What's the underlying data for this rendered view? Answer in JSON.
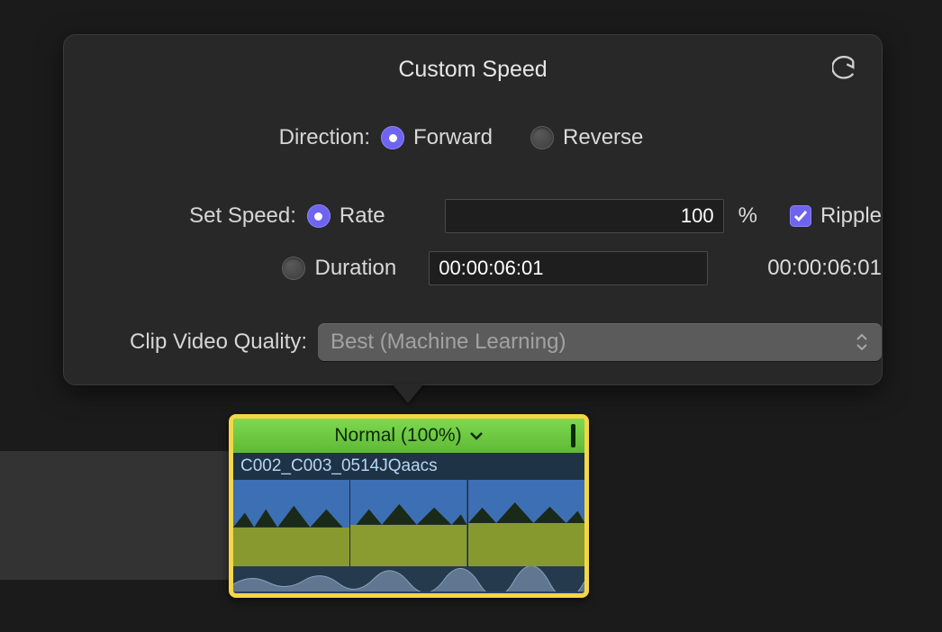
{
  "panel": {
    "title": "Custom Speed",
    "labels": {
      "direction": "Direction:",
      "set_speed": "Set Speed:",
      "clip_quality": "Clip Video Quality:"
    },
    "direction": {
      "forward": "Forward",
      "reverse": "Reverse",
      "selected": "forward"
    },
    "speed": {
      "rate_label": "Rate",
      "duration_label": "Duration",
      "mode_selected": "rate",
      "rate_value": "100",
      "rate_unit": "%",
      "duration_value": "00:00:06:01",
      "source_duration": "00:00:06:01"
    },
    "ripple": {
      "label": "Ripple",
      "checked": true
    },
    "quality": {
      "selected": "Best (Machine Learning)"
    }
  },
  "clip": {
    "speed_badge": "Normal (100%)",
    "name": "C002_C003_0514JQaacs"
  }
}
